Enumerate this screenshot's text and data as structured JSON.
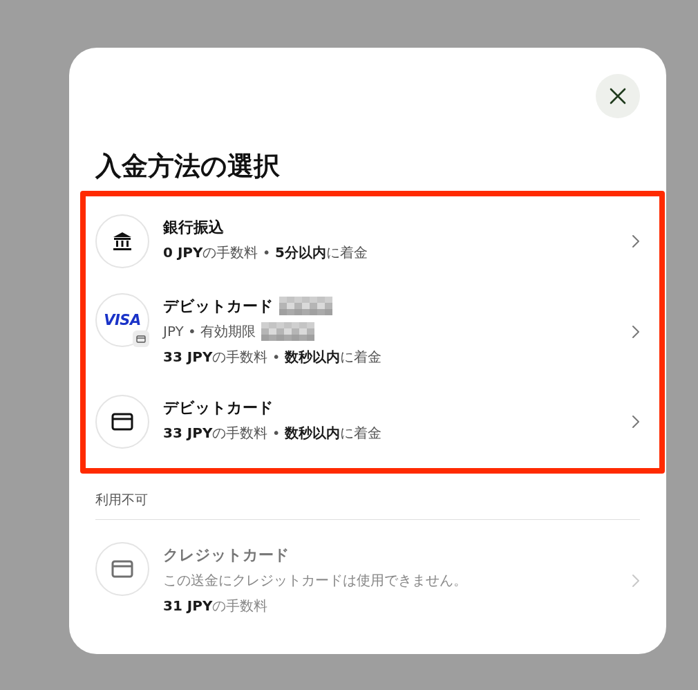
{
  "dialog": {
    "title": "入金方法の選択",
    "available": {
      "highlighted": true,
      "methods": [
        {
          "kind": "bank",
          "title": "銀行振込",
          "title_masked": false,
          "disabled": false,
          "lines": [
            {
              "text": "**0 JPY**の手数料 • **5分以内**に着金",
              "masked": false
            }
          ]
        },
        {
          "kind": "visa",
          "logo": "VISA",
          "title": "デビットカード",
          "title_masked": true,
          "disabled": false,
          "lines": [
            {
              "text": "JPY • 有効期限",
              "masked": true
            },
            {
              "text": "**33 JPY**の手数料 • **数秒以内**に着金",
              "masked": false
            }
          ]
        },
        {
          "kind": "card",
          "title": "デビットカード",
          "title_masked": false,
          "disabled": false,
          "lines": [
            {
              "text": "**33 JPY**の手数料 • **数秒以内**に着金",
              "masked": false
            }
          ]
        }
      ]
    },
    "unavailable": {
      "heading": "利用不可",
      "methods": [
        {
          "kind": "card",
          "title": "クレジットカード",
          "title_masked": false,
          "disabled": true,
          "lines": [
            {
              "text": "この送金にクレジットカードは使用できません。",
              "masked": false
            },
            {
              "text": "**31 JPY**の手数料",
              "masked": false
            }
          ]
        }
      ]
    }
  }
}
